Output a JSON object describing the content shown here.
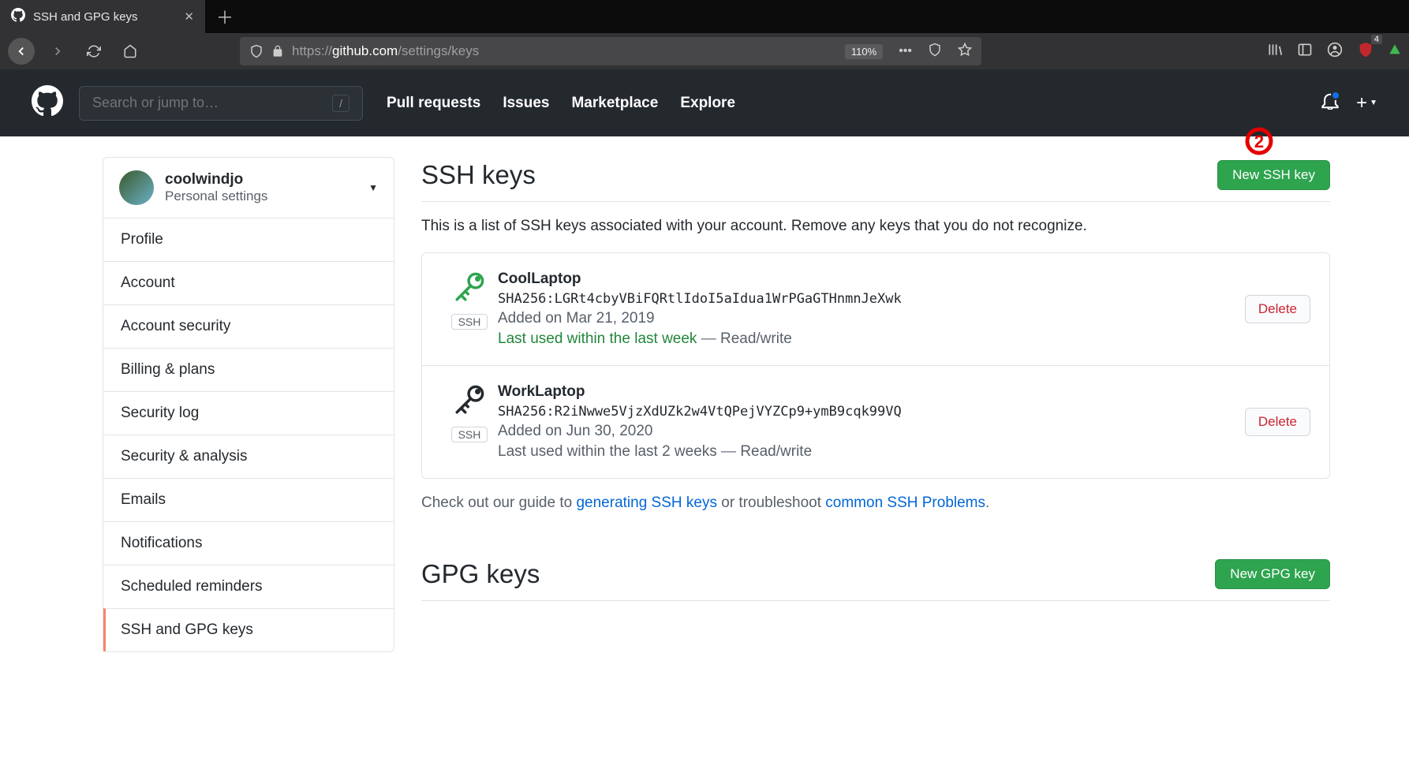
{
  "browser": {
    "tab_title": "SSH and GPG keys",
    "url_prefix": "https://",
    "url_host": "github.com",
    "url_path": "/settings/keys",
    "zoom": "110%",
    "ublock_count": "4"
  },
  "gh": {
    "search_placeholder": "Search or jump to…",
    "slash": "/",
    "nav": {
      "pull": "Pull requests",
      "issues": "Issues",
      "market": "Marketplace",
      "explore": "Explore"
    }
  },
  "sidebar": {
    "username": "coolwindjo",
    "subtext": "Personal settings",
    "items": [
      "Profile",
      "Account",
      "Account security",
      "Billing & plans",
      "Security log",
      "Security & analysis",
      "Emails",
      "Notifications",
      "Scheduled reminders",
      "SSH and GPG keys"
    ]
  },
  "main": {
    "ssh_heading": "SSH keys",
    "new_ssh": "New SSH key",
    "ssh_desc": "This is a list of SSH keys associated with your account. Remove any keys that you do not recognize.",
    "delete": "Delete",
    "ssh_badge": "SSH",
    "keys": [
      {
        "title": "CoolLaptop",
        "fp": "SHA256:LGRt4cbyVBiFQRtlIdoI5aIdua1WrPGaGTHnmnJeXwk",
        "added": "Added on Mar 21, 2019",
        "last_used": "Last used within the last week",
        "rw": "Read/write",
        "recent": true
      },
      {
        "title": "WorkLaptop",
        "fp": "SHA256:R2iNwwe5VjzXdUZk2w4VtQPejVYZCp9+ymB9cqk99VQ",
        "added": "Added on Jun 30, 2020",
        "last_used": "Last used within the last 2 weeks",
        "rw": "Read/write",
        "recent": false
      }
    ],
    "guide_pre": "Check out our guide to ",
    "guide_link1": "generating SSH keys",
    "guide_mid": " or troubleshoot ",
    "guide_link2": "common SSH Problems",
    "guide_end": ".",
    "gpg_heading": "GPG keys",
    "new_gpg": "New GPG key"
  }
}
